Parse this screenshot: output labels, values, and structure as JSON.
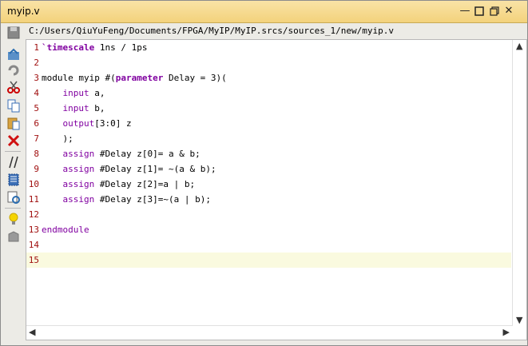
{
  "window": {
    "title": "myip.v"
  },
  "path": "C:/Users/QiuYuFeng/Documents/FPGA/MyIP/MyIP.srcs/sources_1/new/myip.v",
  "editor": {
    "lines": [
      {
        "n": "1",
        "text": ""
      },
      {
        "n": "2",
        "text": ""
      },
      {
        "n": "3",
        "text": ""
      },
      {
        "n": "4",
        "text": ""
      },
      {
        "n": "5",
        "text": ""
      },
      {
        "n": "6",
        "text": ""
      },
      {
        "n": "7",
        "text": ""
      },
      {
        "n": "8",
        "text": ""
      },
      {
        "n": "9",
        "text": ""
      },
      {
        "n": "10",
        "text": ""
      },
      {
        "n": "11",
        "text": ""
      },
      {
        "n": "12",
        "text": ""
      },
      {
        "n": "13",
        "text": ""
      },
      {
        "n": "14",
        "text": ""
      },
      {
        "n": "15",
        "text": ""
      }
    ],
    "code": {
      "l1_kw": "`timescale",
      "l1_rest": " 1ns / 1ps",
      "l3_a": "module myip #(",
      "l3_kw": "parameter",
      "l3_b": " Delay = 3)(",
      "l4_kw": "input",
      "l4_rest": " a,",
      "l5_kw": "input",
      "l5_rest": " b,",
      "l6_kw": "output",
      "l6_rest": "[3:0] z",
      "l7": ");",
      "l8_kw": "assign",
      "l8_rest": " #Delay z[0]= a & b;",
      "l9_kw": "assign",
      "l9_rest": " #Delay z[1]= ~(a & b);",
      "l10_kw": "assign",
      "l10_rest": " #Delay z[2]=a | b;",
      "l11_kw": "assign",
      "l11_rest": " #Delay z[3]=~(a | b);",
      "l13_kw": "endmodule"
    }
  },
  "toolbar_icons": [
    "save-icon",
    "reload-icon",
    "undo-icon",
    "cut-icon",
    "copy-icon",
    "paste-icon",
    "delete-icon",
    "comment-icon",
    "select-all-icon",
    "find-icon",
    "hint-icon",
    "template-icon"
  ],
  "colors": {
    "keyword": "#8000a0",
    "line_number": "#a01010",
    "current_line": "#fafadf",
    "title_bar": "#f3d27c"
  }
}
